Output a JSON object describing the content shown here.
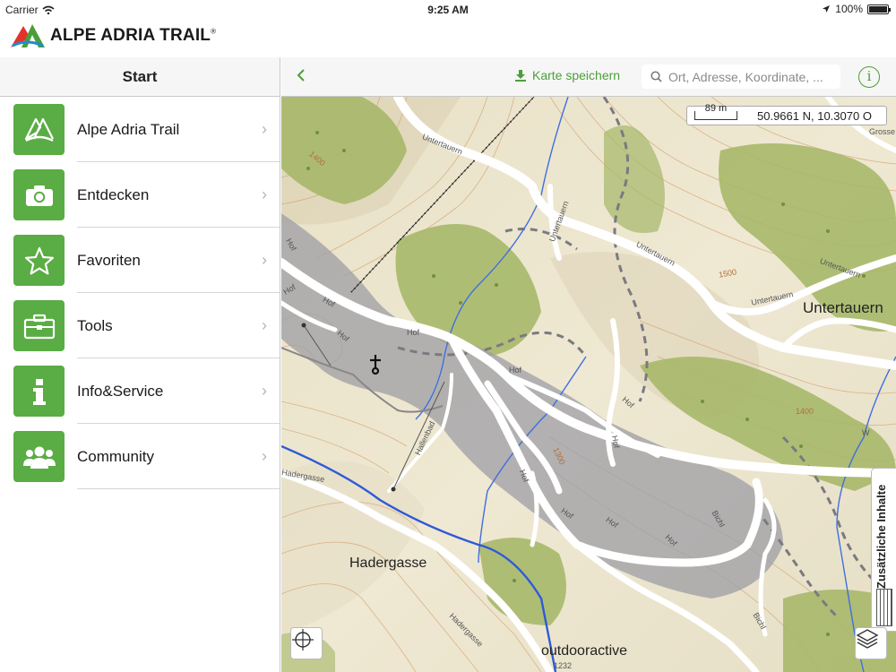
{
  "status_bar": {
    "carrier": "Carrier",
    "time": "9:25 AM",
    "battery": "100%"
  },
  "brand": {
    "name": "ALPE ADRIA TRAIL",
    "registered": "®"
  },
  "sidebar": {
    "title": "Start",
    "items": [
      {
        "label": "Alpe Adria Trail",
        "icon": "trail-logo-icon"
      },
      {
        "label": "Entdecken",
        "icon": "camera-icon"
      },
      {
        "label": "Favoriten",
        "icon": "star-icon"
      },
      {
        "label": "Tools",
        "icon": "toolbox-icon"
      },
      {
        "label": "Info&Service",
        "icon": "info-icon"
      },
      {
        "label": "Community",
        "icon": "community-icon"
      }
    ]
  },
  "map_toolbar": {
    "save_label": "Karte speichern",
    "search_placeholder": "Ort, Adresse, Koordinate, ...",
    "info_symbol": "i"
  },
  "map": {
    "scale": "89 m",
    "coordinates": "50.9661 N, 10.3070 O",
    "places": [
      "Untertauern",
      "Hadergasse"
    ],
    "streets": [
      "Untertauern",
      "Untertauern",
      "Untertauern",
      "Untertauern",
      "Untertauern",
      "Hof",
      "Hof",
      "Hof",
      "Hof",
      "Hof",
      "Hof",
      "Hof",
      "Hof",
      "Hof",
      "Hof",
      "Hof",
      "Hof",
      "Hallenbad",
      "Bichl",
      "Bichl",
      "Hadergasse",
      "Hadergasse",
      "Grosse",
      "W"
    ],
    "contours": [
      "1400",
      "1500",
      "1400",
      "1300",
      "1300"
    ],
    "side_panel_label": "Zusätzliche Inhalte",
    "attribution": "outdooractive",
    "partial_label": "1232"
  },
  "colors": {
    "accent": "#5aac44",
    "map_background": "#efe8d4",
    "forest": "#a7b86a",
    "settlement": "#9e9ea4"
  }
}
